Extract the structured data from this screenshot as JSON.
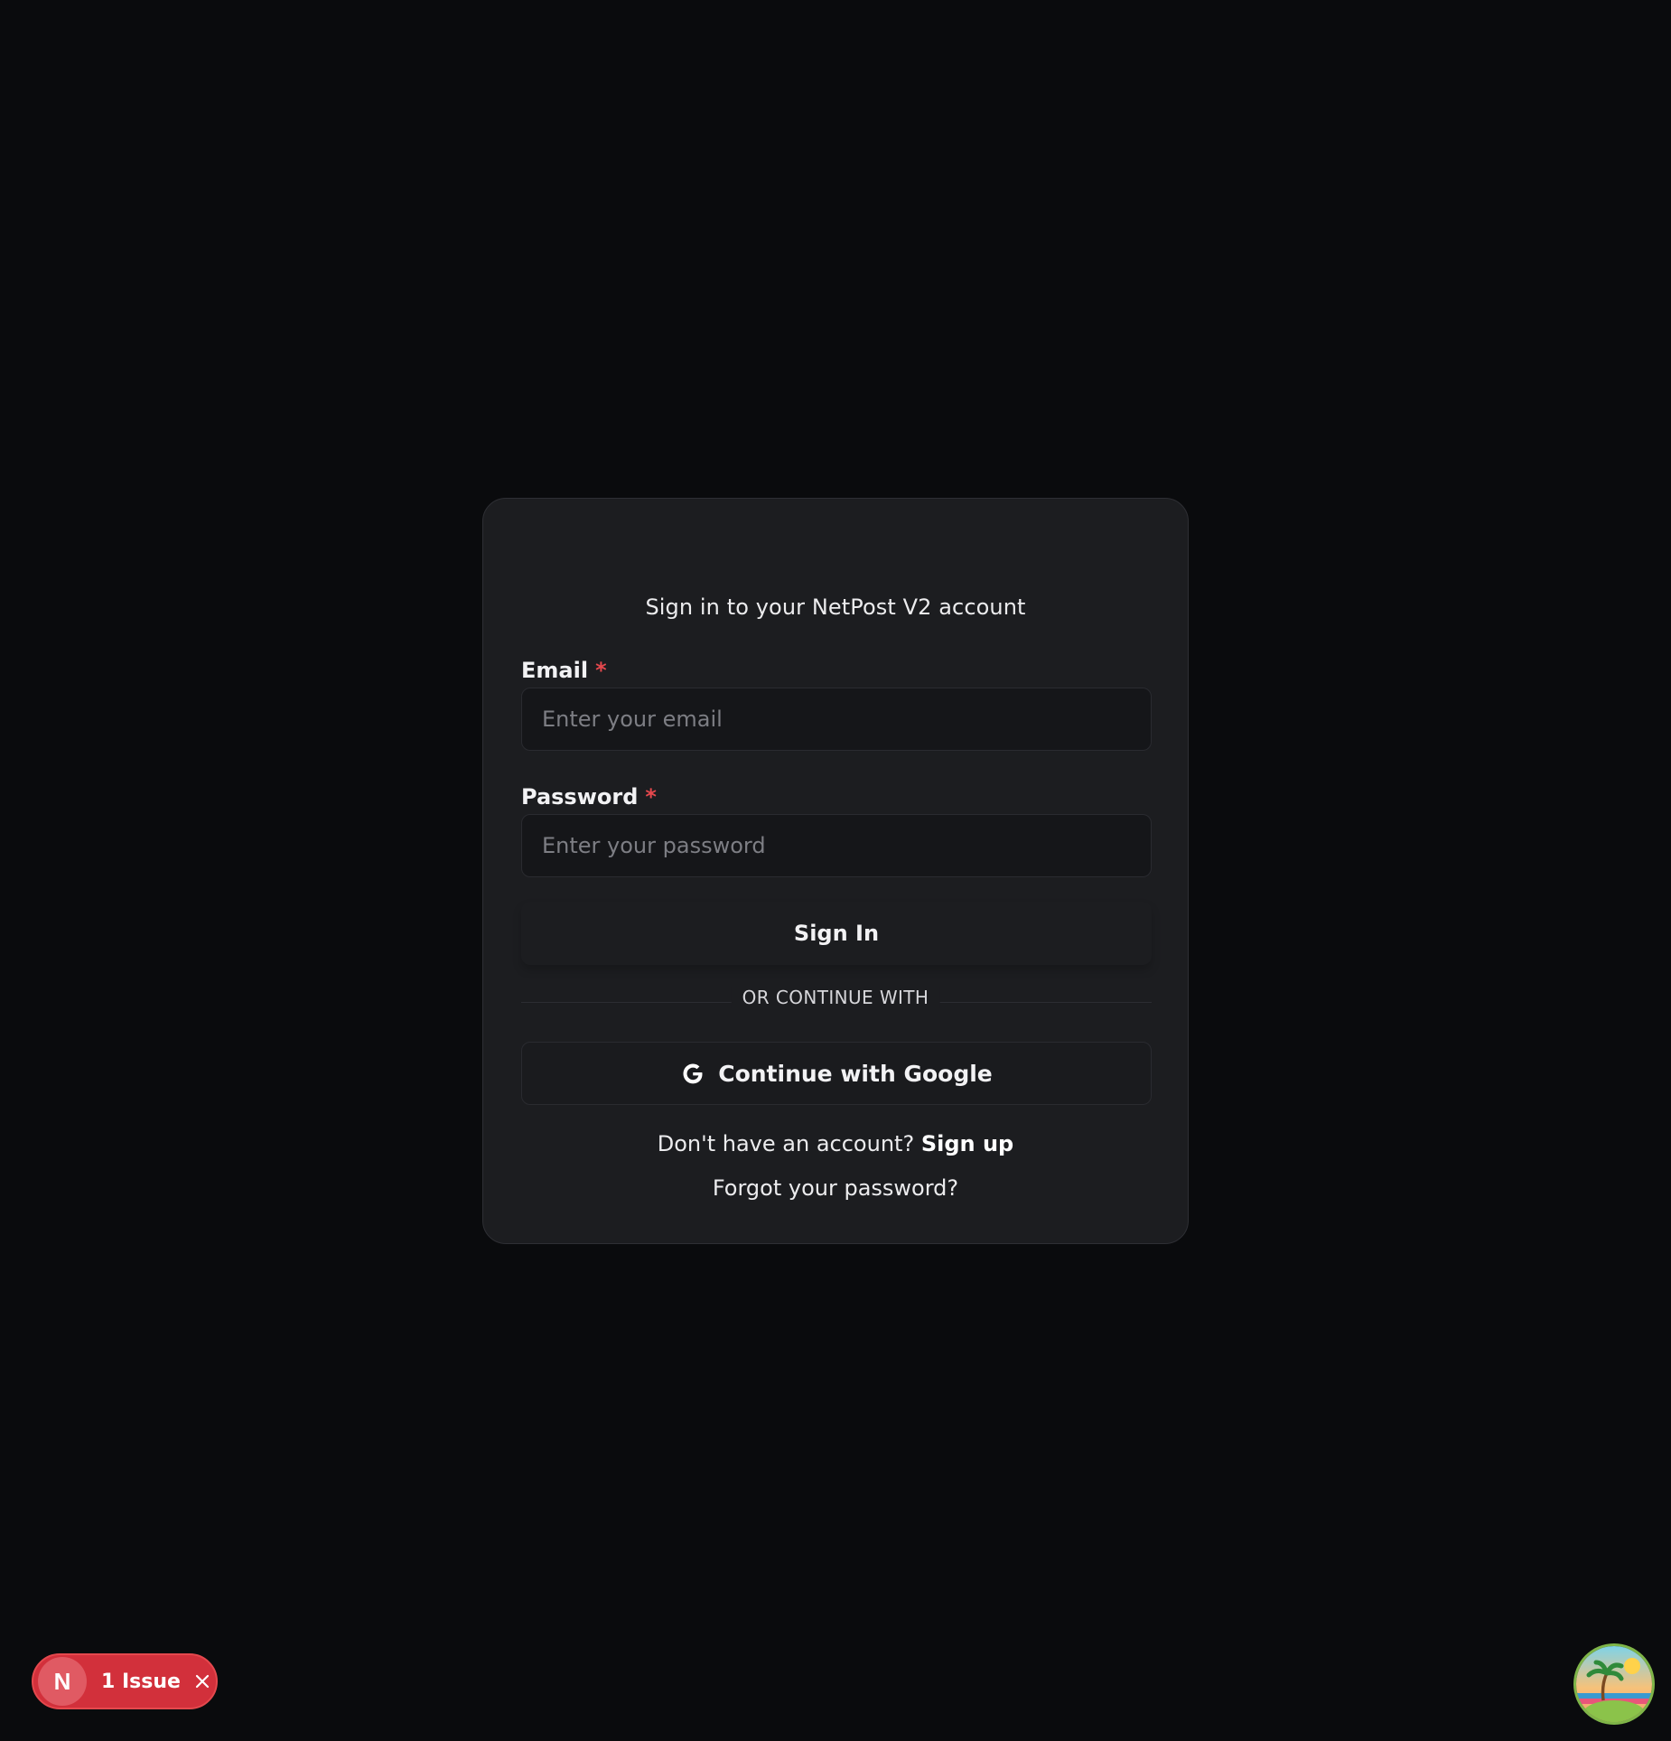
{
  "login": {
    "subtitle": "Sign in to your NetPost V2 account",
    "email": {
      "label": "Email",
      "required_mark": "*",
      "placeholder": "Enter your email",
      "value": ""
    },
    "password": {
      "label": "Password",
      "required_mark": "*",
      "placeholder": "Enter your password",
      "value": ""
    },
    "sign_in_label": "Sign In",
    "divider_text": "OR CONTINUE WITH",
    "google_label": "Continue with Google",
    "no_account_text": "Don't have an account?",
    "sign_up_label": "Sign up",
    "forgot_label": "Forgot your password?"
  },
  "issues_badge": {
    "logo_letter": "N",
    "label": "1 Issue"
  },
  "icons": {
    "google": "google-g-icon",
    "close": "close-icon",
    "avatar": "island-avatar-icon"
  },
  "colors": {
    "background": "#0a0b0d",
    "card": "#1c1d20",
    "required": "#e5484d",
    "issue_badge": "#d2303b"
  }
}
